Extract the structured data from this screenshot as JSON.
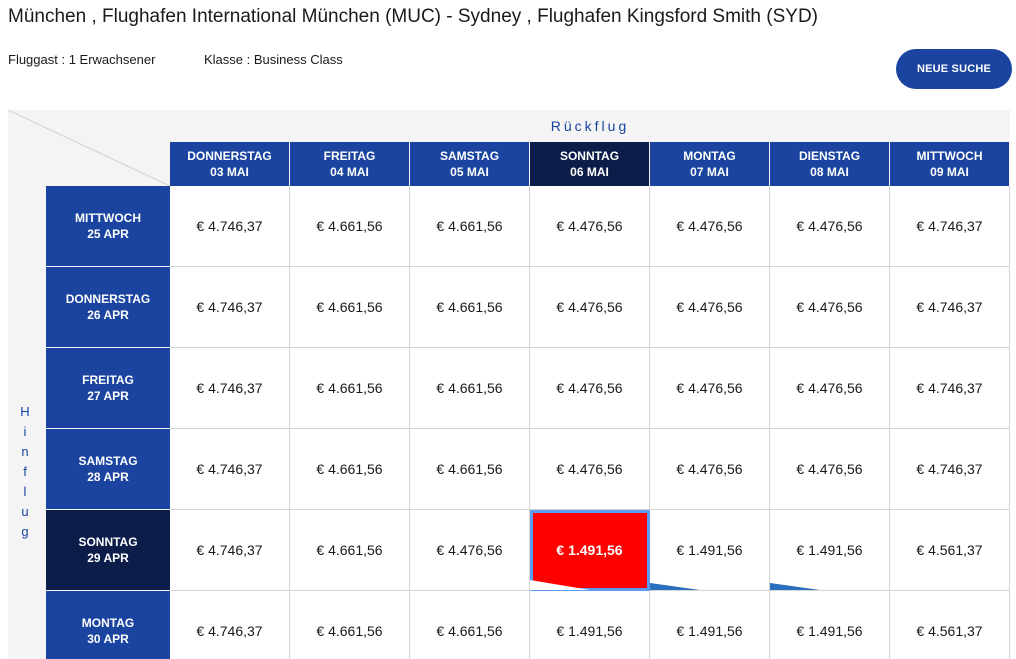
{
  "header": {
    "title": "München , Flughafen International München (MUC) - Sydney , Flughafen Kingsford Smith (SYD)",
    "passengers": "Fluggast : 1 Erwachsener",
    "klasse": "Klasse : Business Class",
    "new_search_label": "NEUE SUCHE"
  },
  "matrix": {
    "return_label": "Rückflug",
    "outbound_label": [
      "H",
      "i",
      "n",
      "f",
      "l",
      "u",
      "g"
    ],
    "columns": [
      {
        "day": "DONNERSTAG",
        "date": "03 MAI"
      },
      {
        "day": "FREITAG",
        "date": "04 MAI"
      },
      {
        "day": "SAMSTAG",
        "date": "05 MAI"
      },
      {
        "day": "SONNTAG",
        "date": "06 MAI"
      },
      {
        "day": "MONTAG",
        "date": "07 MAI"
      },
      {
        "day": "DIENSTAG",
        "date": "08 MAI"
      },
      {
        "day": "MITTWOCH",
        "date": "09 MAI"
      }
    ],
    "rows": [
      {
        "day": "MITTWOCH",
        "date": "25 APR"
      },
      {
        "day": "DONNERSTAG",
        "date": "26 APR"
      },
      {
        "day": "FREITAG",
        "date": "27 APR"
      },
      {
        "day": "SAMSTAG",
        "date": "28 APR"
      },
      {
        "day": "SONNTAG",
        "date": "29 APR"
      },
      {
        "day": "MONTAG",
        "date": "30 APR"
      }
    ],
    "prices": [
      [
        "€ 4.746,37",
        "€ 4.661,56",
        "€ 4.661,56",
        "€ 4.476,56",
        "€ 4.476,56",
        "€ 4.476,56",
        "€ 4.746,37"
      ],
      [
        "€ 4.746,37",
        "€ 4.661,56",
        "€ 4.661,56",
        "€ 4.476,56",
        "€ 4.476,56",
        "€ 4.476,56",
        "€ 4.746,37"
      ],
      [
        "€ 4.746,37",
        "€ 4.661,56",
        "€ 4.661,56",
        "€ 4.476,56",
        "€ 4.476,56",
        "€ 4.476,56",
        "€ 4.746,37"
      ],
      [
        "€ 4.746,37",
        "€ 4.661,56",
        "€ 4.661,56",
        "€ 4.476,56",
        "€ 4.476,56",
        "€ 4.476,56",
        "€ 4.746,37"
      ],
      [
        "€ 4.746,37",
        "€ 4.661,56",
        "€ 4.476,56",
        "€ 1.491,56",
        "€ 1.491,56",
        "€ 1.491,56",
        "€ 4.561,37"
      ],
      [
        "€ 4.746,37",
        "€ 4.661,56",
        "€ 4.661,56",
        "€ 1.491,56",
        "€ 1.491,56",
        "€ 1.491,56",
        "€ 4.561,37"
      ]
    ],
    "selected_row": 4,
    "selected_col": 3,
    "cheapest_marked": [
      [
        4,
        3
      ],
      [
        4,
        4
      ],
      [
        4,
        5
      ]
    ]
  },
  "colors": {
    "primary": "#1a44a0",
    "selected_header": "#0c1d4a",
    "selected_cell": "#ff0000",
    "selection_outline": "#5b9bf0",
    "cheapest_marker": "#2a6fc0"
  }
}
